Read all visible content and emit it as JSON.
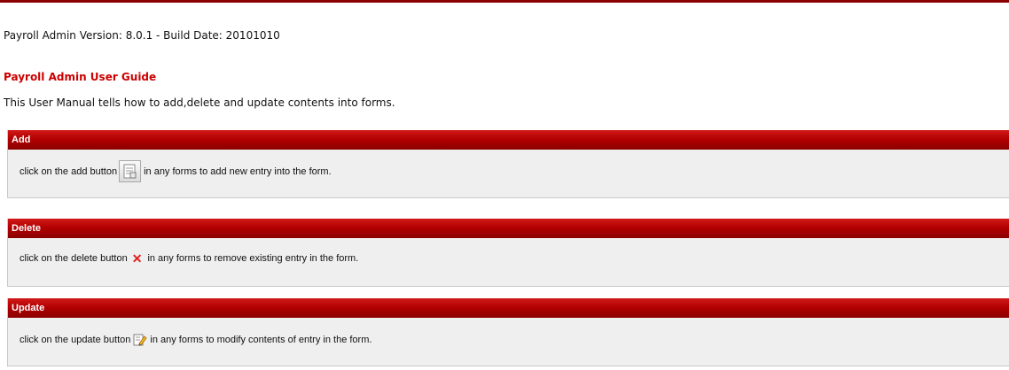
{
  "header": {
    "version_line": "Payroll Admin Version: 8.0.1 - Build Date: 20101010",
    "guide_title": "Payroll Admin User Guide",
    "intro": "This User Manual tells how to add,delete and update contents into forms."
  },
  "sections": {
    "add": {
      "title": "Add",
      "text_before": "click on the add button",
      "text_after": "in any forms to add new entry into the form.",
      "icon": "add-form-icon"
    },
    "delete": {
      "title": "Delete",
      "text_before": "click on the delete button",
      "text_after": "in any forms to remove existing entry in the form.",
      "icon": "delete-x-icon"
    },
    "update": {
      "title": "Update",
      "text_before": "click on the update button",
      "text_after": "in any forms to modify contents of entry in the form.",
      "icon": "edit-pencil-icon"
    }
  },
  "colors": {
    "accent_red": "#cc0000",
    "header_bar": "#b30000",
    "panel_bg": "#efefef"
  }
}
